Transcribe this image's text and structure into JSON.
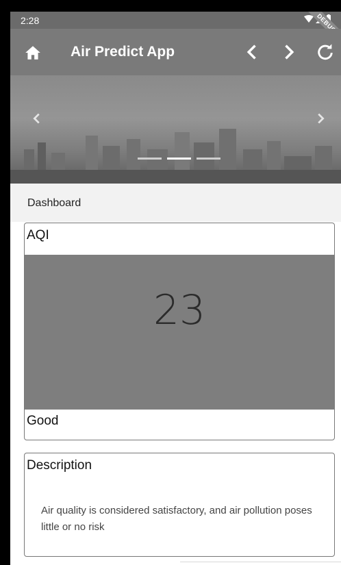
{
  "status_bar": {
    "time": "2:28",
    "debug_label": "DEBUG"
  },
  "app_bar": {
    "title": "Air Predict App",
    "icons": {
      "home": "home-icon",
      "back": "chevron-left-icon",
      "forward": "chevron-right-icon",
      "refresh": "refresh-icon"
    }
  },
  "banner": {
    "slides_count": 3,
    "active_index": 1
  },
  "dashboard": {
    "label": "Dashboard"
  },
  "aqi_card": {
    "title": "AQI",
    "value": "23",
    "category": "Good"
  },
  "description_card": {
    "title": "Description",
    "text": "Air quality is considered satisfactory, and air pollution poses little or no risk"
  },
  "colors": {
    "app_bar": "#7a7a7a",
    "aqi_box": "#7e7e7e"
  }
}
